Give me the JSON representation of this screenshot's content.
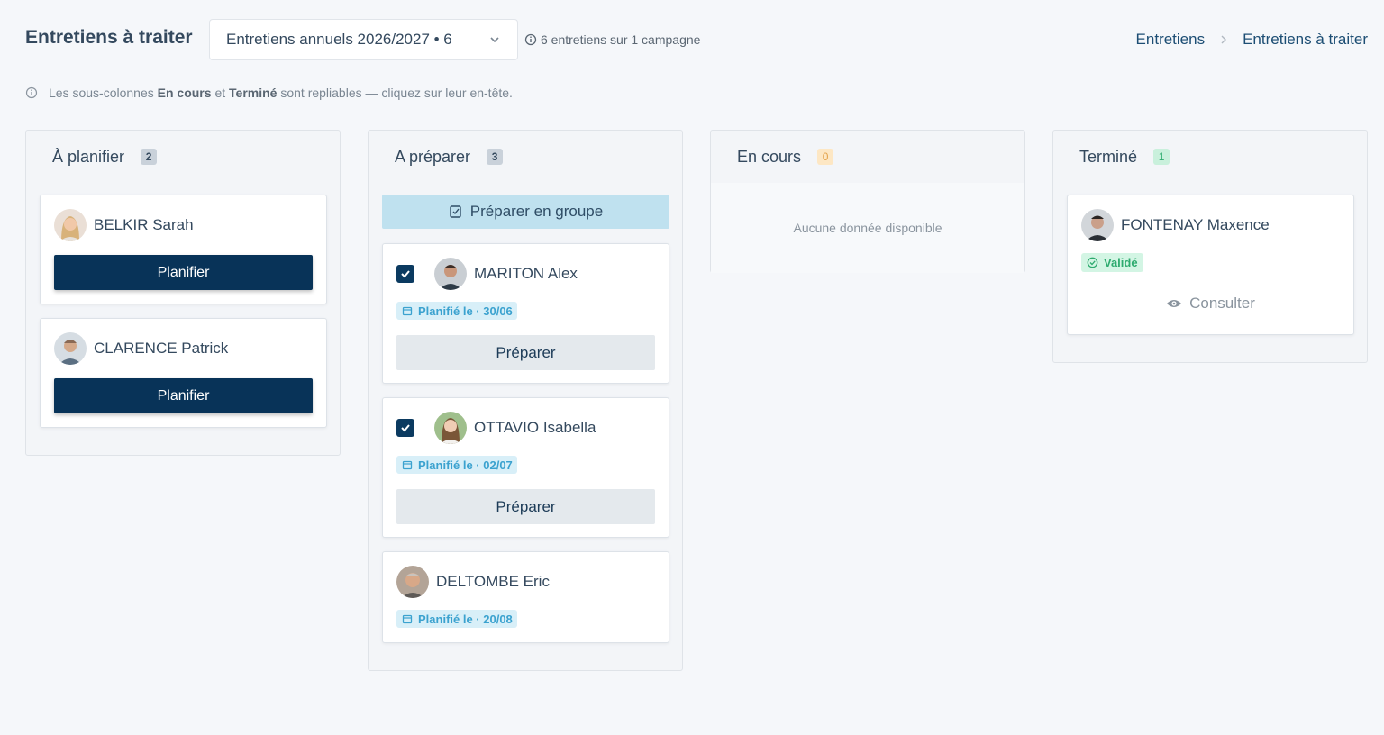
{
  "header": {
    "title": "Entretiens à traiter",
    "campaign_select": "Entretiens annuels 2026/2027 • 6",
    "count_info": "6 entretiens sur 1 campagne",
    "breadcrumb": [
      "Entretiens",
      "Entretiens à traiter"
    ]
  },
  "hint": {
    "prefix": "Les sous-colonnes",
    "term1": "En cours",
    "mid": "et",
    "term2": "Terminé",
    "suffix": "sont repliables — cliquez sur leur en-tête."
  },
  "columns": {
    "planifier": {
      "title": "À planifier",
      "count": "2",
      "cards": [
        {
          "name": "BELKIR Sarah",
          "action": "Planifier"
        },
        {
          "name": "CLARENCE Patrick",
          "action": "Planifier"
        }
      ]
    },
    "preparer": {
      "title": "A préparer",
      "count": "3",
      "group_button": "Préparer en groupe",
      "cards": [
        {
          "name": "MARITON Alex",
          "date": "Planifié le · 30/06",
          "action": "Préparer"
        },
        {
          "name": "OTTAVIO Isabella",
          "date": "Planifié le · 02/07",
          "action": "Préparer"
        },
        {
          "name": "DELTOMBE Eric",
          "date": "Planifié le · 20/08"
        }
      ]
    },
    "en_cours": {
      "title": "En cours",
      "count": "0",
      "empty": "Aucune donnée disponible"
    },
    "termine": {
      "title": "Terminé",
      "count": "1",
      "cards": [
        {
          "name": "FONTENAY Maxence",
          "status": "Validé",
          "action": "Consulter"
        }
      ]
    }
  },
  "colors": {
    "primary": "#083358",
    "accent_blue": "#3ba2cf",
    "success": "#2eab6f",
    "warning": "#e3a24a"
  },
  "icons": {
    "info": "info-circle-icon",
    "chevron": "chevron-down-icon",
    "calendar": "calendar-icon",
    "check": "check-icon",
    "eye": "eye-icon",
    "group": "edit-checklist-icon"
  }
}
